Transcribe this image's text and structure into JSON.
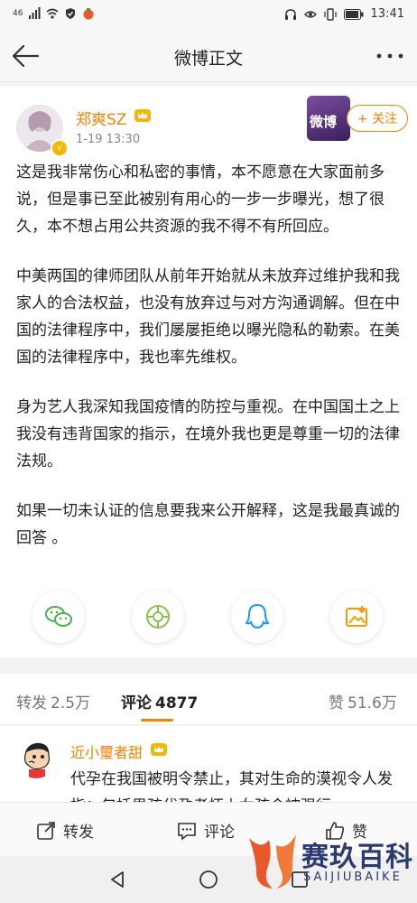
{
  "status_bar": {
    "signal": "46",
    "time": "13:41"
  },
  "nav": {
    "title": "微博正文"
  },
  "post": {
    "author": "郑爽SZ",
    "time": "1-19 13:30",
    "cover_text": "微博",
    "follow_label": "+ 关注",
    "paragraphs": [
      "这是我非常伤心和私密的事情，本不愿意在大家面前多说，但是事已至此被别有用心的一步一步曝光，想了很久，本不想占用公共资源的我不得不有所回应。",
      "中美两国的律师团队从前年开始就从未放弃过维护我和我家人的合法权益，也没有放弃过与对方沟通调解。但在中国的法律程序中，我们屡屡拒绝以曝光隐私的勒索。在美国的法律程序中，我也率先维权。",
      "身为艺人我深知我国疫情的防控与重视。在中国国土之上我没有违背国家的指示，在境外我也更是尊重一切的法律法规。",
      "如果一切未认证的信息要我来公开解释，这是我最真诚的回答 。"
    ],
    "share": [
      {
        "name": "wechat-icon",
        "color": "#4caf50"
      },
      {
        "name": "moments-icon",
        "color": "#8bc34a"
      },
      {
        "name": "qq-icon",
        "color": "#2196f3"
      },
      {
        "name": "save-image-icon",
        "color": "#ff9800"
      }
    ]
  },
  "tabs": {
    "repost": {
      "label": "转发",
      "count": "2.5万"
    },
    "comment": {
      "label": "评论",
      "count": "4877"
    },
    "like": {
      "label": "赞",
      "count": "51.6万"
    }
  },
  "comment": {
    "author": "近小璽者甜",
    "text": "代孕在我国被明令禁止，其对生命的漠视令人发指：包括男孩代孕者怀上女孩会被强行"
  },
  "bottom": {
    "repost": "转发",
    "comment": "评论",
    "like": "赞"
  },
  "watermark": {
    "cn": "赛玖百科",
    "en": "SAIJIUBAIKE"
  },
  "colors": {
    "accent": "#f08300",
    "text": "#222222"
  }
}
